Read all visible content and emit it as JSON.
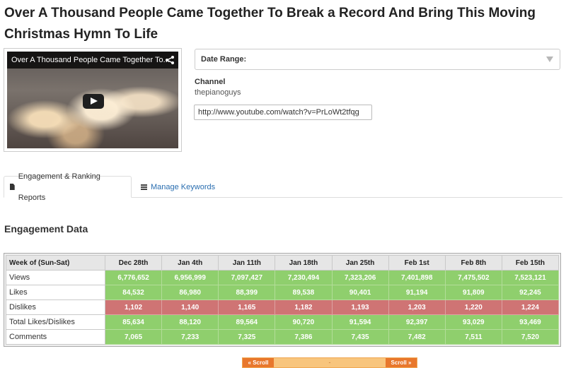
{
  "page": {
    "title": "Over A Thousand People Came Together To Break a Record And Bring This Moving Christmas Hymn To Life"
  },
  "video": {
    "overlay_title": "Over A Thousand People Came Together To...",
    "share_icon": "share-icon",
    "play_icon": "play-icon"
  },
  "filters": {
    "date_range_label": "Date Range:",
    "channel_label": "Channel",
    "channel_name": "thepianoguys",
    "url_value": "http://www.youtube.com/watch?v=PrLoWt2tfqg"
  },
  "tabs": [
    {
      "label": "Engagement & Ranking Reports",
      "icon": "document-icon",
      "active": true
    },
    {
      "label": "Manage Keywords",
      "icon": "list-icon",
      "active": false
    }
  ],
  "section": {
    "title": "Engagement Data"
  },
  "table": {
    "header_label": "Week of (Sun-Sat)",
    "weeks": [
      "Dec 28th",
      "Jan 4th",
      "Jan 11th",
      "Jan 18th",
      "Jan 25th",
      "Feb 1st",
      "Feb 8th",
      "Feb 15th"
    ],
    "rows": [
      {
        "label": "Views",
        "status": "green",
        "values": [
          "6,776,652",
          "6,956,999",
          "7,097,427",
          "7,230,494",
          "7,323,206",
          "7,401,898",
          "7,475,502",
          "7,523,121"
        ]
      },
      {
        "label": "Likes",
        "status": "green",
        "values": [
          "84,532",
          "86,980",
          "88,399",
          "89,538",
          "90,401",
          "91,194",
          "91,809",
          "92,245"
        ]
      },
      {
        "label": "Dislikes",
        "status": "red",
        "values": [
          "1,102",
          "1,140",
          "1,165",
          "1,182",
          "1,193",
          "1,203",
          "1,220",
          "1,224"
        ]
      },
      {
        "label": "Total Likes/Dislikes",
        "status": "green",
        "values": [
          "85,634",
          "88,120",
          "89,564",
          "90,720",
          "91,594",
          "92,397",
          "93,029",
          "93,469"
        ]
      },
      {
        "label": "Comments",
        "status": "green",
        "values": [
          "7,065",
          "7,233",
          "7,325",
          "7,386",
          "7,435",
          "7,482",
          "7,511",
          "7,520"
        ]
      }
    ]
  },
  "scroll": {
    "left_label": "« Scroll",
    "middle_label": "-",
    "right_label": "Scroll »"
  },
  "colors": {
    "good": "#8fcf6d",
    "bad": "#cf7474",
    "link": "#2a6eb0",
    "scroll_accent": "#e8772c"
  }
}
